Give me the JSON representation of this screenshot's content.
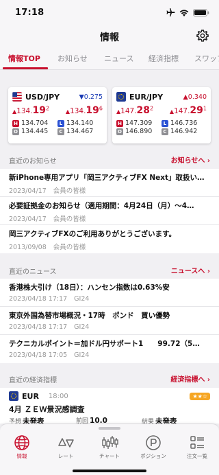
{
  "status": {
    "time": "17:18"
  },
  "nav": {
    "title": "情報"
  },
  "tabs": [
    "情報TOP",
    "お知らせ",
    "ニュース",
    "経済指標",
    "スワップ"
  ],
  "rates": [
    {
      "pair": "USD/JPY",
      "change": "0.275",
      "direction": "down",
      "bid_prefix": "134.",
      "bid_big": "19",
      "bid_sup": "2",
      "ask_prefix": "134.",
      "ask_big": "19",
      "ask_sup": "6",
      "high": "134.704",
      "low": "134.140",
      "open": "134.445",
      "close": "134.467"
    },
    {
      "pair": "EUR/JPY",
      "change": "0.340",
      "direction": "up",
      "bid_prefix": "147.",
      "bid_big": "28",
      "bid_sup": "2",
      "ask_prefix": "147.",
      "ask_big": "29",
      "ask_sup": "1",
      "high": "147.309",
      "low": "146.736",
      "open": "146.890",
      "close": "146.942"
    }
  ],
  "badges": {
    "high": "H",
    "low": "L",
    "open": "O",
    "close": "C"
  },
  "notices": {
    "title": "直近のお知らせ",
    "link": "お知らせへ ›",
    "items": [
      {
        "title": "新iPhone専用アプリ「岡三アクティブFX Next」取扱い…",
        "date": "2023/04/17",
        "target": "会員の皆様"
      },
      {
        "title": "必要証拠金のお知らせ（適用期間：4月24日（月）～4…",
        "date": "2023/04/17",
        "target": "会員の皆様"
      },
      {
        "title": "岡三アクティブFXのご利用ありがとうございます。",
        "date": "2013/09/08",
        "target": "会員の皆様"
      }
    ]
  },
  "news": {
    "title": "直近のニュース",
    "link": "ニュースへ ›",
    "items": [
      {
        "title": "香港株大引け（18日）：ハンセン指数は0.63%安",
        "date": "2023/04/18 17:17",
        "source": "GI24"
      },
      {
        "title": "東京外国為替市場概況・17時　ポンド　買い優勢",
        "date": "2023/04/18 17:17",
        "source": "GI24"
      },
      {
        "title": "テクニカルポイント＝加ドル円サポート1　　99.72（5…",
        "date": "2023/04/18 17:05",
        "source": "GI24"
      }
    ]
  },
  "economic": {
    "title": "直近の経済指標",
    "link": "経済指標へ ›",
    "item": {
      "currency": "EUR",
      "time": "18:00",
      "stars": "★★☆",
      "name": "4月 ＺＥＷ景況感調査",
      "forecast_label": "予想",
      "forecast": "未発表",
      "previous_label": "前回",
      "previous": "10.0",
      "result_label": "結果",
      "result": "未発表"
    }
  },
  "tabbar": [
    "情報",
    "レート",
    "チャート",
    "ポジション",
    "注文一覧"
  ],
  "colors": {
    "accent": "#c8102e",
    "down": "#1a3bb5",
    "low_badge": "#2b52d4"
  }
}
